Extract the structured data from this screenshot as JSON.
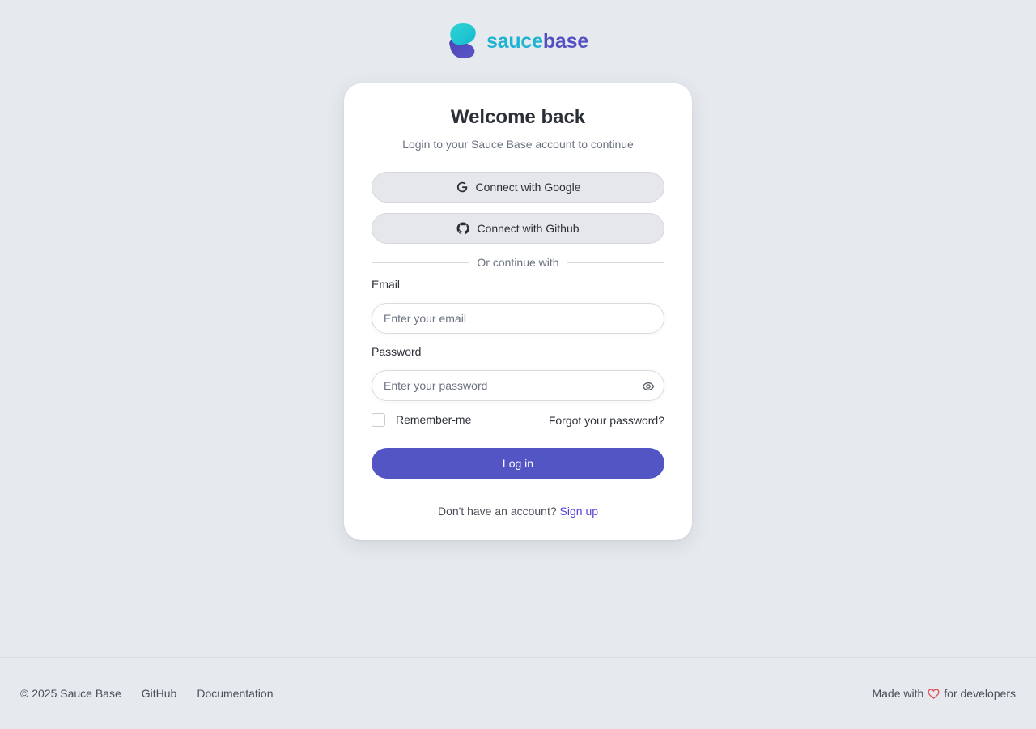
{
  "brand": {
    "name_part1": "sauce",
    "name_part2": "base",
    "color_teal": "#1fb3d2",
    "color_indigo": "#5550c2"
  },
  "card": {
    "title": "Welcome back",
    "subtitle": "Login to your Sauce Base account to continue",
    "google_button": "Connect with Google",
    "github_button": "Connect with Github",
    "divider_text": "Or continue with",
    "email_label": "Email",
    "email_placeholder": "Enter your email",
    "password_label": "Password",
    "password_placeholder": "Enter your password",
    "remember_label": "Remember-me",
    "forgot_link": "Forgot your password?",
    "login_button": "Log in",
    "signup_prompt": "Don't have an account?",
    "signup_link": "Sign up"
  },
  "footer": {
    "copyright": "© 2025 Sauce Base",
    "github_link": "GitHub",
    "docs_link": "Documentation",
    "made_with": "Made with",
    "for_developers": "for developers"
  },
  "icons": {
    "google": "google-icon",
    "github": "github-icon",
    "eye": "eye-icon",
    "heart": "heart-icon"
  },
  "colors": {
    "primary": "#5455c5",
    "link": "#4f3fd8",
    "heart": "#e5484d",
    "background": "#e6eaee"
  }
}
